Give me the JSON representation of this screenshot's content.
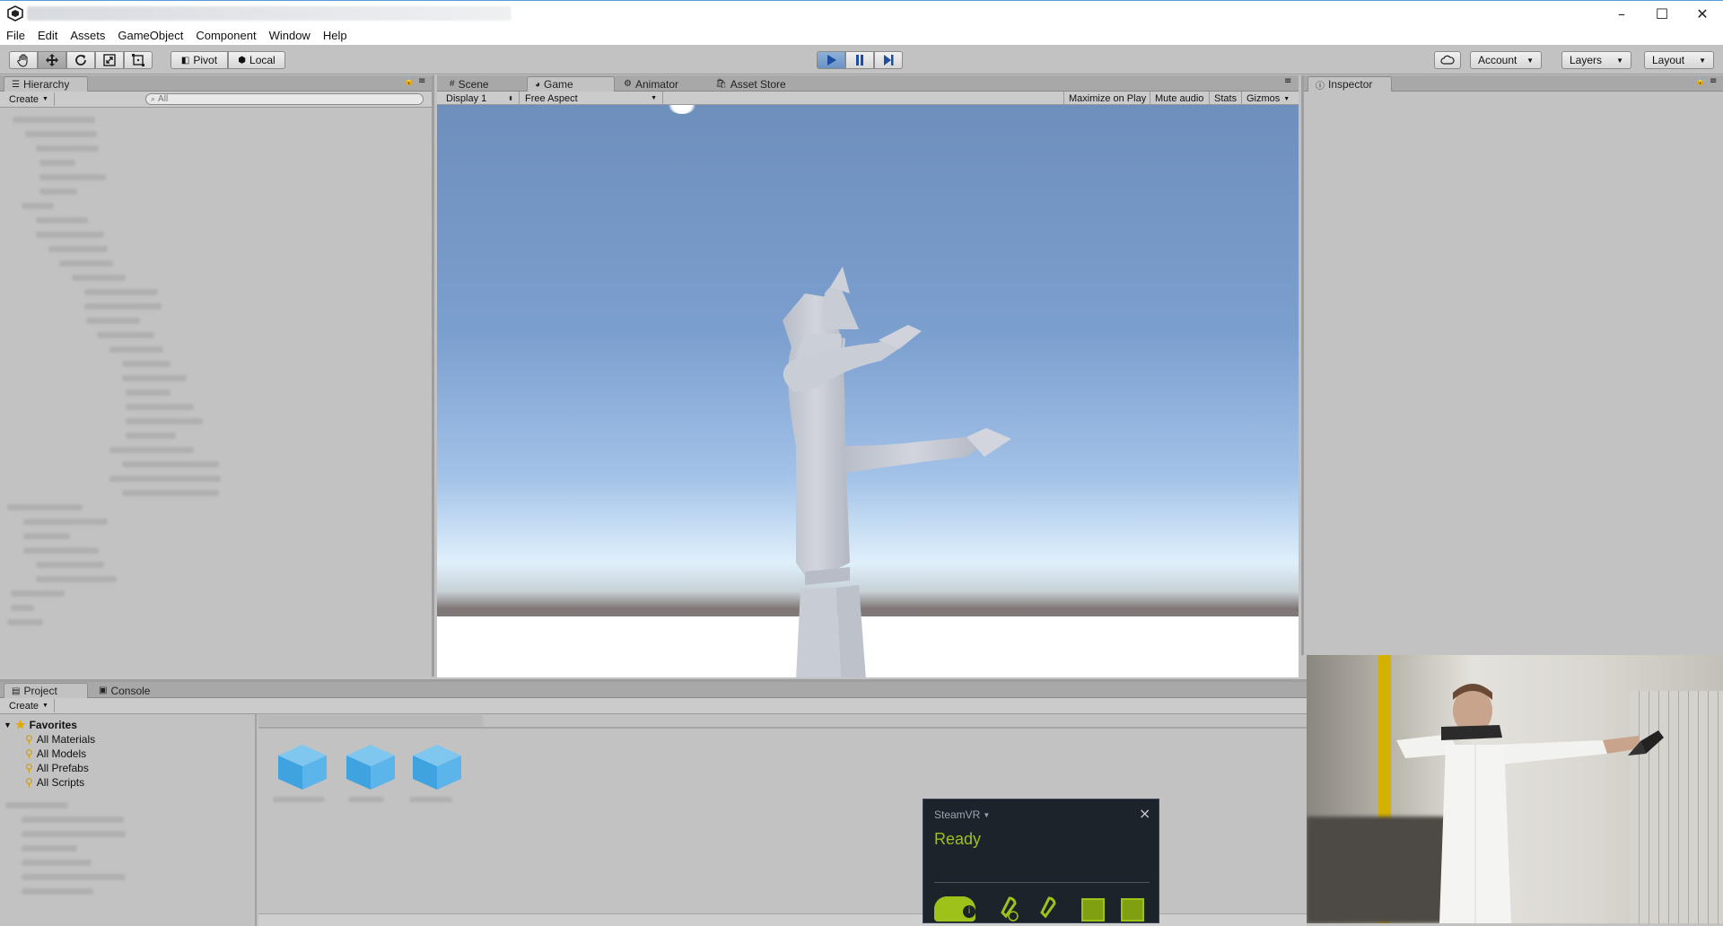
{
  "titlebar": {
    "minimize": "–",
    "maximize": "☐",
    "close": "✕"
  },
  "menu": [
    "File",
    "Edit",
    "Assets",
    "GameObject",
    "Component",
    "Window",
    "Help"
  ],
  "toolbar": {
    "pivot_label": "Pivot",
    "local_label": "Local",
    "account_label": "Account",
    "layers_label": "Layers",
    "layout_label": "Layout"
  },
  "hierarchy": {
    "tab": "Hierarchy",
    "create": "Create",
    "search_placeholder": "All"
  },
  "center_tabs": {
    "scene": "Scene",
    "game": "Game",
    "animator": "Animator",
    "asset_store": "Asset Store"
  },
  "game": {
    "display": "Display 1",
    "aspect": "Free Aspect",
    "maximize_on_play": "Maximize on Play",
    "mute_audio": "Mute audio",
    "stats": "Stats",
    "gizmos": "Gizmos"
  },
  "inspector": {
    "tab": "Inspector"
  },
  "project": {
    "tab": "Project",
    "console_tab": "Console",
    "create": "Create",
    "favorites_label": "Favorites",
    "favorites": [
      "All Materials",
      "All Models",
      "All Prefabs",
      "All Scripts"
    ]
  },
  "steamvr": {
    "title": "SteamVR",
    "status": "Ready",
    "close": "×",
    "accent": "#9ec21a"
  }
}
